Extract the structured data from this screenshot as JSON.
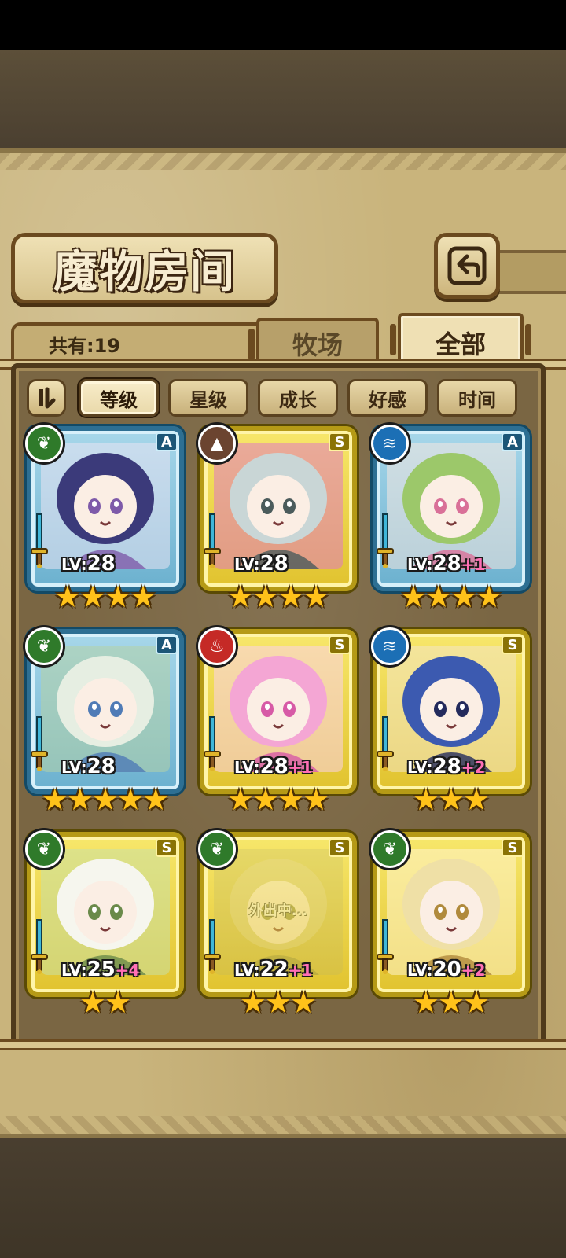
{
  "screen": {
    "title": "魔物房间",
    "back_icon": "return-arrow-icon"
  },
  "header": {
    "count_label": "共有:19"
  },
  "tabs": [
    {
      "label": "牧场",
      "active": false
    },
    {
      "label": "全部",
      "active": true
    }
  ],
  "sort": {
    "toggle_icon": "sort-toggle-icon",
    "options": [
      {
        "label": "等级",
        "active": true
      },
      {
        "label": "星级",
        "active": false
      },
      {
        "label": "成长",
        "active": false
      },
      {
        "label": "好感",
        "active": false
      },
      {
        "label": "时间",
        "active": false
      }
    ]
  },
  "monsters": [
    {
      "rank": "A",
      "element": "nature",
      "level": "28",
      "bonus": "",
      "stars": 4,
      "status": "",
      "palette": [
        "#3b3a7a",
        "#e9e3f2",
        "#7e5aa9"
      ]
    },
    {
      "rank": "S",
      "element": "earth",
      "level": "28",
      "bonus": "",
      "stars": 4,
      "status": "",
      "palette": [
        "#c9d6d6",
        "#e07ac3",
        "#4b5b5b"
      ]
    },
    {
      "rank": "A",
      "element": "water",
      "level": "28",
      "bonus": "+1",
      "stars": 4,
      "status": "",
      "palette": [
        "#9cc86a",
        "#f6e7e0",
        "#d97098"
      ]
    },
    {
      "rank": "A",
      "element": "nature",
      "level": "28",
      "bonus": "",
      "stars": 5,
      "status": "",
      "palette": [
        "#e6eee2",
        "#b4d2a6",
        "#4f7bb6"
      ]
    },
    {
      "rank": "S",
      "element": "fire",
      "level": "28",
      "bonus": "+1",
      "stars": 4,
      "status": "",
      "palette": [
        "#f4a6d4",
        "#f9d2ea",
        "#d75aa6"
      ]
    },
    {
      "rank": "S",
      "element": "water",
      "level": "28",
      "bonus": "+2",
      "stars": 3,
      "status": "",
      "palette": [
        "#3c5ab0",
        "#f3e6c6",
        "#232a5c"
      ]
    },
    {
      "rank": "S",
      "element": "nature",
      "level": "25",
      "bonus": "+4",
      "stars": 2,
      "status": "",
      "palette": [
        "#f6f6ee",
        "#c9e0a6",
        "#6a8a4a"
      ]
    },
    {
      "rank": "S",
      "element": "nature",
      "level": "22",
      "bonus": "+1",
      "stars": 3,
      "status": "外出中...",
      "palette": [
        "#d9cf8a",
        "#b8b36c",
        "#8a8a4a"
      ]
    },
    {
      "rank": "S",
      "element": "nature",
      "level": "20",
      "bonus": "+2",
      "stars": 3,
      "status": "",
      "palette": [
        "#efe0a6",
        "#fff4cc",
        "#b08a3c"
      ]
    }
  ],
  "labels": {
    "lv_prefix": "LV:"
  }
}
